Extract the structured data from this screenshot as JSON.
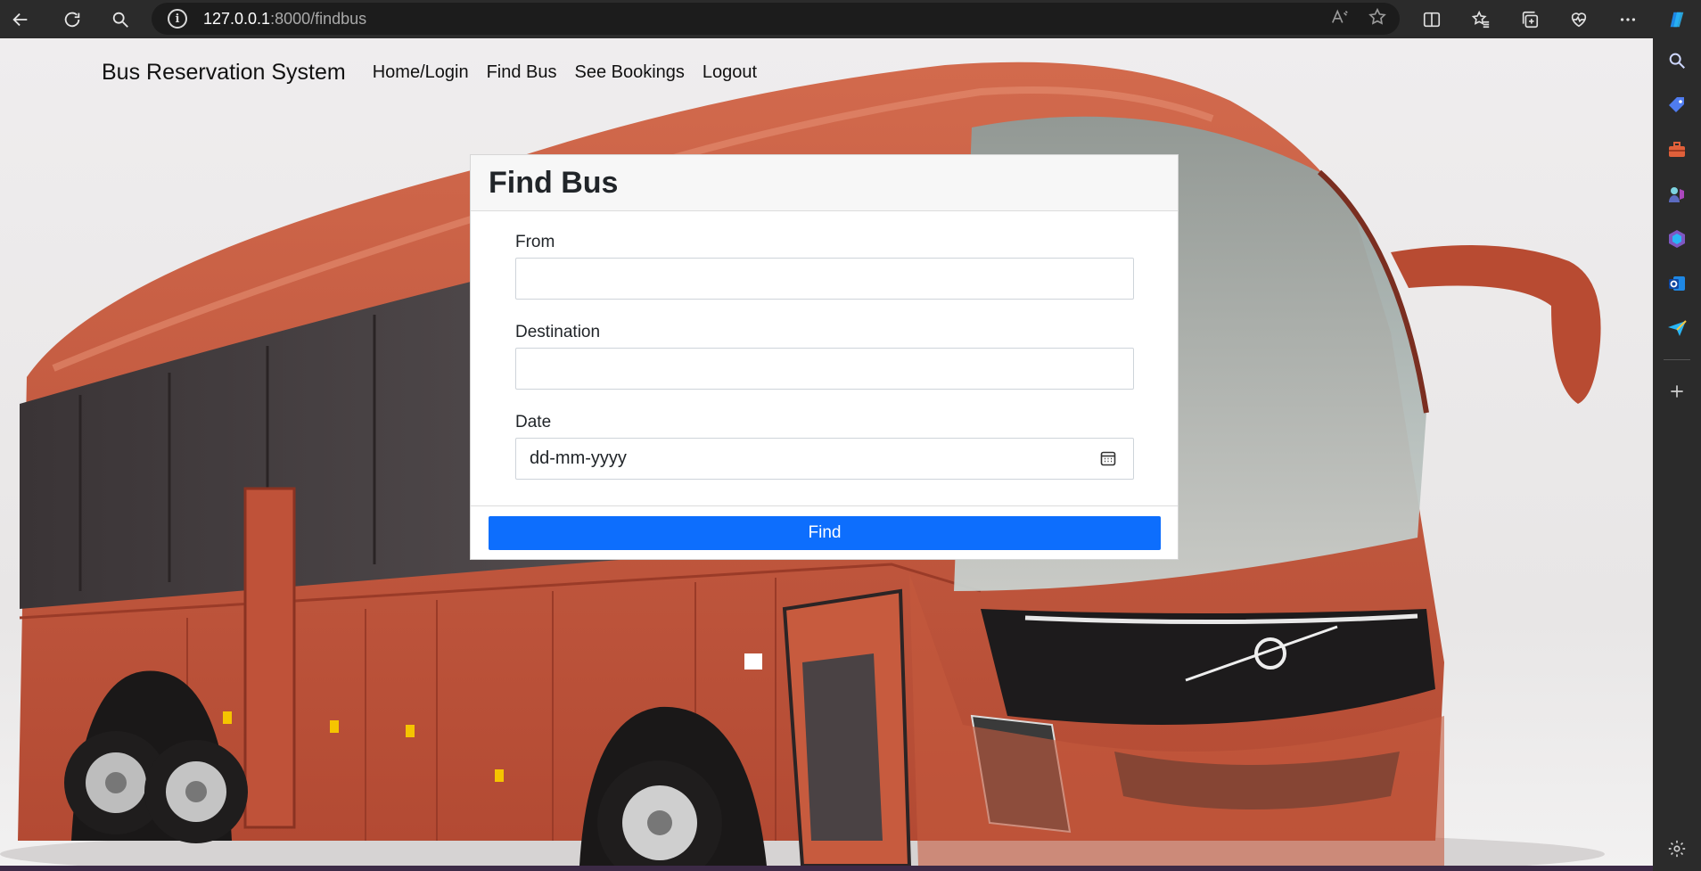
{
  "browser": {
    "url_host": "127.0.0.1",
    "url_path": ":8000/findbus"
  },
  "navbar": {
    "brand": "Bus Reservation System",
    "links": [
      "Home/Login",
      "Find Bus",
      "See Bookings",
      "Logout"
    ]
  },
  "form": {
    "title": "Find Bus",
    "from_label": "From",
    "from_value": "",
    "destination_label": "Destination",
    "destination_value": "",
    "date_label": "Date",
    "date_placeholder": "dd-mm-yyyy",
    "submit_label": "Find"
  },
  "colors": {
    "primary": "#0d6efd",
    "bus_body": "#c4553b",
    "chrome_bg": "#2b2b2b"
  },
  "icons": [
    "back-icon",
    "refresh-icon",
    "search-icon",
    "info-icon",
    "read-aloud-icon",
    "favorite-icon",
    "split-screen-icon",
    "favorites-icon",
    "collections-icon",
    "health-icon",
    "more-icon",
    "copilot-icon",
    "calendar-icon"
  ]
}
